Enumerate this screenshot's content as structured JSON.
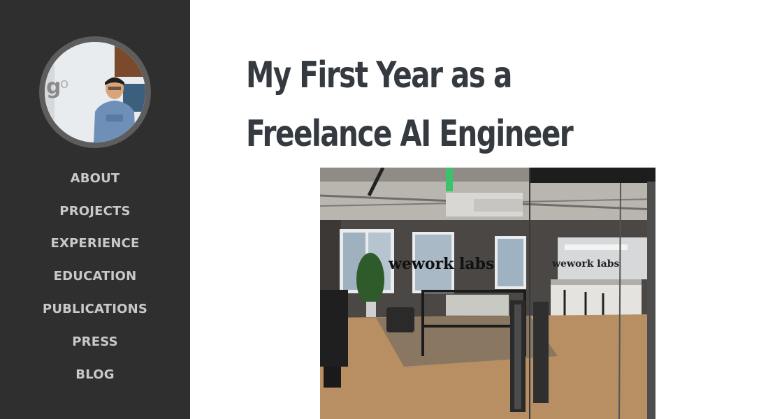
{
  "sidebar": {
    "avatar_alt": "Profile photo",
    "items": [
      {
        "label": "ABOUT"
      },
      {
        "label": "PROJECTS"
      },
      {
        "label": "EXPERIENCE"
      },
      {
        "label": "EDUCATION"
      },
      {
        "label": "PUBLICATIONS"
      },
      {
        "label": "PRESS"
      },
      {
        "label": "BLOG"
      }
    ]
  },
  "post": {
    "title": "My First Year as a Freelance AI Engineer",
    "photo_sign_left": "wework labs",
    "photo_sign_right": "wework labs"
  },
  "colors": {
    "sidebar_bg": "#2f2f2f",
    "nav_text": "#c9c9c9",
    "title_text": "#343a40"
  }
}
